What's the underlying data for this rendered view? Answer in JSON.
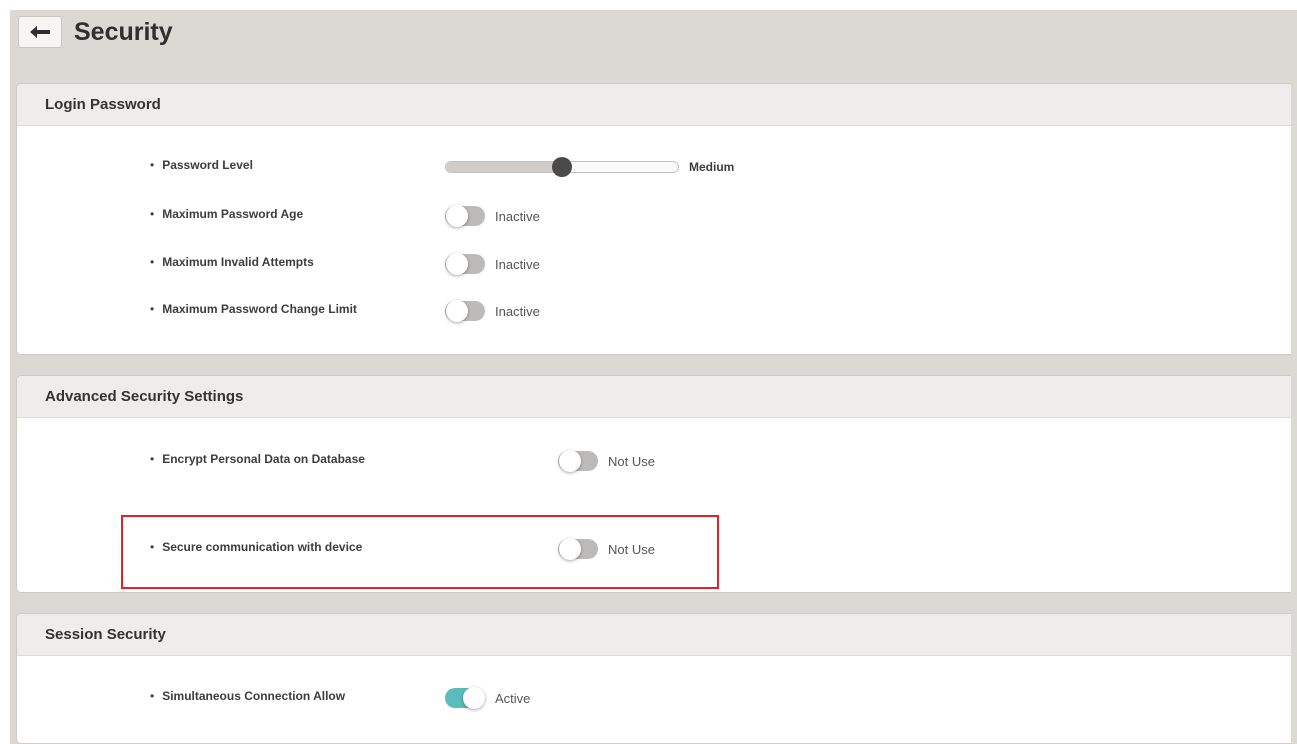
{
  "header": {
    "back_label": "←",
    "title": "Security"
  },
  "login_password": {
    "title": "Login Password",
    "password_level": {
      "label": "Password Level",
      "value_text": "Medium",
      "level": 0.5
    },
    "max_age": {
      "label": "Maximum Password Age",
      "status": "Inactive"
    },
    "max_invalid": {
      "label": "Maximum Invalid Attempts",
      "status": "Inactive"
    },
    "max_change": {
      "label": "Maximum Password Change Limit",
      "status": "Inactive"
    }
  },
  "advanced": {
    "title": "Advanced Security Settings",
    "encrypt": {
      "label": "Encrypt Personal Data on Database",
      "status": "Not Use"
    },
    "secure_comm": {
      "label": "Secure communication with device",
      "status": "Not Use"
    }
  },
  "session": {
    "title": "Session Security",
    "simultaneous": {
      "label": "Simultaneous Connection Allow",
      "status": "Active"
    }
  },
  "colors": {
    "page_bg": "#dcd8d3",
    "toggle_on": "#5bbcbc",
    "toggle_off": "#bdbbb9",
    "highlight": "#e4202a"
  }
}
